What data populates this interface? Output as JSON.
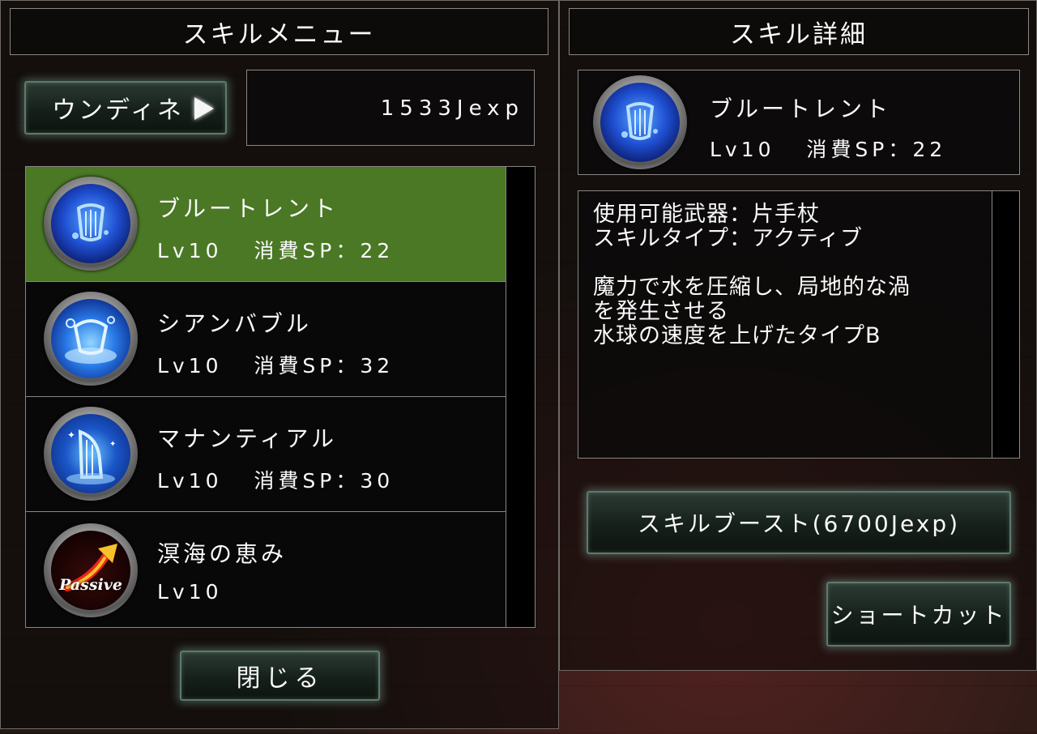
{
  "left_panel": {
    "title": "スキルメニュー",
    "job_button_label": "ウンディネ",
    "jexp_value": "1533Jexp",
    "close_button_label": "閉じる",
    "skills": [
      {
        "name": "ブルートレント",
        "meta": "Lv10   消費SP：22",
        "icon": "water-harp-icon",
        "selected": true
      },
      {
        "name": "シアンバブル",
        "meta": "Lv10   消費SP：32",
        "icon": "water-bubble-harp-icon",
        "selected": false
      },
      {
        "name": "マナンティアル",
        "meta": "Lv10   消費SP：30",
        "icon": "blue-harp-icon",
        "selected": false
      },
      {
        "name": "溟海の恵み",
        "meta": "Lv10",
        "icon": "passive-icon",
        "selected": false
      }
    ],
    "passive_badge_text": "Passive"
  },
  "right_panel": {
    "title": "スキル詳細",
    "skill_name": "ブルートレント",
    "skill_meta": "Lv10   消費SP：22",
    "description": {
      "line1": "使用可能武器：片手杖",
      "line2": "スキルタイプ：アクティブ",
      "line3": "魔力で水を圧縮し、局地的な渦",
      "line4": "を発生させる",
      "line5": "水球の速度を上げたタイプB"
    },
    "boost_button_label": "スキルブースト(6700Jexp)",
    "shortcut_button_label": "ショートカット"
  },
  "colors": {
    "selected_row": "#50822a",
    "button_glow": "#96c8b4"
  }
}
